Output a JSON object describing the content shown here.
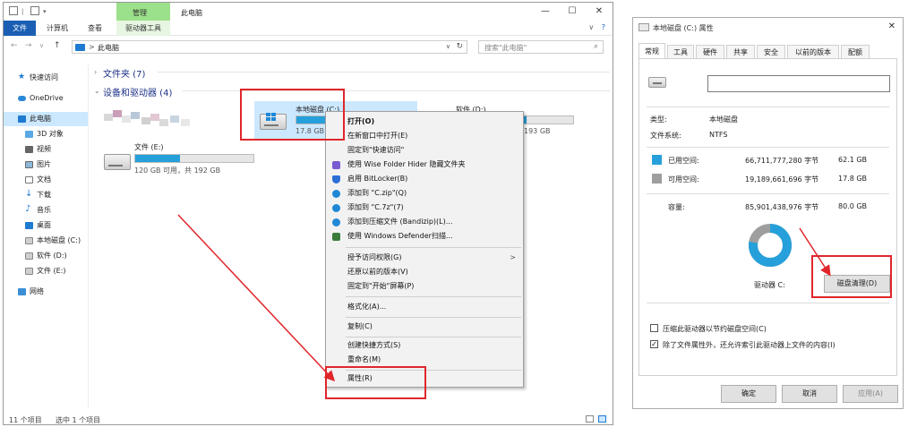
{
  "colors": {
    "explorer_file_tab": "#1a5fb4",
    "manage_tab": "#9be08a",
    "selection": "#cce8ff",
    "used_space": "#26a0da",
    "free_space": "#9e9e9e",
    "annotation_red": "#e0262b"
  },
  "explorer": {
    "contextual_tab_group": "管理",
    "window_title": "此电脑",
    "window_buttons": {
      "minimize": "—",
      "maximize": "☐",
      "close": "✕"
    },
    "ribbon_tabs": [
      "文件",
      "计算机",
      "查看",
      "驱动器工具"
    ],
    "ribbon_right_icons": [
      "chevron-down-icon",
      "help-icon"
    ],
    "address": {
      "path": "此电脑",
      "chevron": ">",
      "dropdown": "∨",
      "refresh": "↻"
    },
    "search": {
      "placeholder": "搜索\"此电脑\""
    },
    "nav": {
      "back": "←",
      "forward": "→",
      "recent": "∨",
      "up": "↑"
    },
    "sidebar": [
      {
        "label": "快速访问",
        "icon": "star-icon"
      },
      {
        "label": "OneDrive",
        "icon": "cloud-icon"
      },
      {
        "label": "此电脑",
        "icon": "computer-icon",
        "selected": true
      },
      {
        "label": "3D 对象",
        "icon": "cube-icon"
      },
      {
        "label": "视频",
        "icon": "video-icon"
      },
      {
        "label": "图片",
        "icon": "picture-icon"
      },
      {
        "label": "文档",
        "icon": "document-icon"
      },
      {
        "label": "下载",
        "icon": "download-icon"
      },
      {
        "label": "音乐",
        "icon": "music-icon"
      },
      {
        "label": "桌面",
        "icon": "desktop-icon"
      },
      {
        "label": "本地磁盘 (C:)",
        "icon": "drive-icon"
      },
      {
        "label": "软件 (D:)",
        "icon": "drive-icon"
      },
      {
        "label": "文件 (E:)",
        "icon": "drive-icon"
      },
      {
        "label": "网络",
        "icon": "network-icon"
      }
    ],
    "groups": {
      "folders": "文件夹 (7)",
      "drives": "设备和驱动器 (4)"
    },
    "drives": {
      "c": {
        "name": "本地磁盘 (C:)",
        "free_label": "17.8 GB",
        "used_fraction": 0.776
      },
      "d": {
        "name": "软件 (D:)",
        "free_partial": "193 GB"
      },
      "e": {
        "name": "文件 (E:)",
        "free_label": "120 GB 可用，共 192 GB",
        "used_fraction": 0.375
      }
    },
    "status": {
      "count": "11 个项目",
      "selected": "选中 1 个项目"
    }
  },
  "context_menu": {
    "items": [
      {
        "label": "打开(O)",
        "bold": true
      },
      {
        "label": "在新窗口中打开(E)"
      },
      {
        "label": "固定到\"快速访问\""
      },
      {
        "label": "使用 Wise Folder Hider 隐藏文件夹",
        "icon": "wise-folder-hider-icon"
      },
      {
        "label": "启用 BitLocker(B)",
        "icon": "shield-icon"
      },
      {
        "label": "添加到 \"C.zip\"(Q)",
        "icon": "bandizip-icon"
      },
      {
        "label": "添加到 \"C.7z\"(7)",
        "icon": "bandizip-icon"
      },
      {
        "label": "添加到压缩文件 (Bandizip)(L)...",
        "icon": "bandizip-icon"
      },
      {
        "label": "使用 Windows Defender扫描...",
        "icon": "defender-icon"
      },
      {
        "label": "授予访问权限(G)",
        "submenu": true
      },
      {
        "label": "还原以前的版本(V)"
      },
      {
        "label": "固定到\"开始\"屏幕(P)"
      },
      {
        "label": "格式化(A)..."
      },
      {
        "label": "复制(C)"
      },
      {
        "label": "创建快捷方式(S)"
      },
      {
        "label": "重命名(M)"
      },
      {
        "label": "属性(R)"
      }
    ],
    "submenu_arrow": ">"
  },
  "properties": {
    "title": "本地磁盘 (C:) 属性",
    "close": "✕",
    "tabs": [
      "常规",
      "工具",
      "硬件",
      "共享",
      "安全",
      "以前的版本",
      "配额"
    ],
    "name_value": "",
    "type_label": "类型:",
    "type_value": "本地磁盘",
    "fs_label": "文件系统:",
    "fs_value": "NTFS",
    "used_label": "已用空间:",
    "used_bytes": "66,711,777,280 字节",
    "used_size": "62.1 GB",
    "free_label": "可用空间:",
    "free_bytes": "19,189,661,696 字节",
    "free_size": "17.8 GB",
    "capacity_label": "容量:",
    "capacity_bytes": "85,901,438,976 字节",
    "capacity_size": "80.0 GB",
    "used_fraction": 0.776,
    "drive_label": "驱动器 C:",
    "cleanup_button": "磁盘清理(D)",
    "compress_label": "压缩此驱动器以节约磁盘空间(C)",
    "compress_checked": false,
    "index_label": "除了文件属性外，还允许索引此驱动器上文件的内容(I)",
    "index_checked": true,
    "checkmark": "✓",
    "ok": "确定",
    "cancel": "取消",
    "apply": "应用(A)"
  }
}
